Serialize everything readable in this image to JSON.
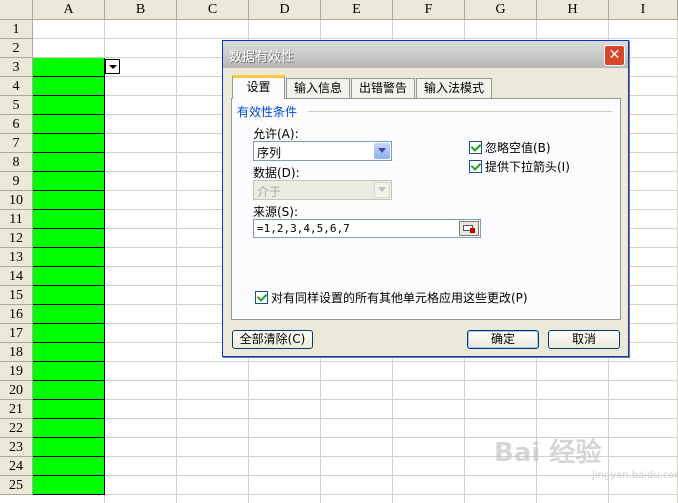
{
  "sheet": {
    "columns": [
      "A",
      "B",
      "C",
      "D",
      "E",
      "F",
      "G",
      "H",
      "I"
    ],
    "rows": [
      "1",
      "2",
      "3",
      "4",
      "5",
      "6",
      "7",
      "8",
      "9",
      "10",
      "11",
      "12",
      "13",
      "14",
      "15",
      "16",
      "17",
      "18",
      "19",
      "20",
      "21",
      "22",
      "23",
      "24",
      "25"
    ],
    "fill_color": "#00ff00"
  },
  "dialog": {
    "title": "数据有效性",
    "close_glyph": "✕",
    "tabs": [
      "设置",
      "输入信息",
      "出错警告",
      "输入法模式"
    ],
    "group_label": "有效性条件",
    "allow_label": "允许(A):",
    "allow_value": "序列",
    "data_label": "数据(D):",
    "data_value": "介于",
    "source_label": "来源(S):",
    "source_value": "=1,2,3,4,5,6,7",
    "ignore_blank_label": "忽略空值(B)",
    "dropdown_label": "提供下拉箭头(I)",
    "apply_all_label": "对有同样设置的所有其他单元格应用这些更改(P)",
    "clear_all_button": "全部清除(C)",
    "ok_button": "确定",
    "cancel_button": "取消"
  },
  "watermark": {
    "text": "Bai 经验",
    "sub": "jingyan.baidu.com"
  }
}
